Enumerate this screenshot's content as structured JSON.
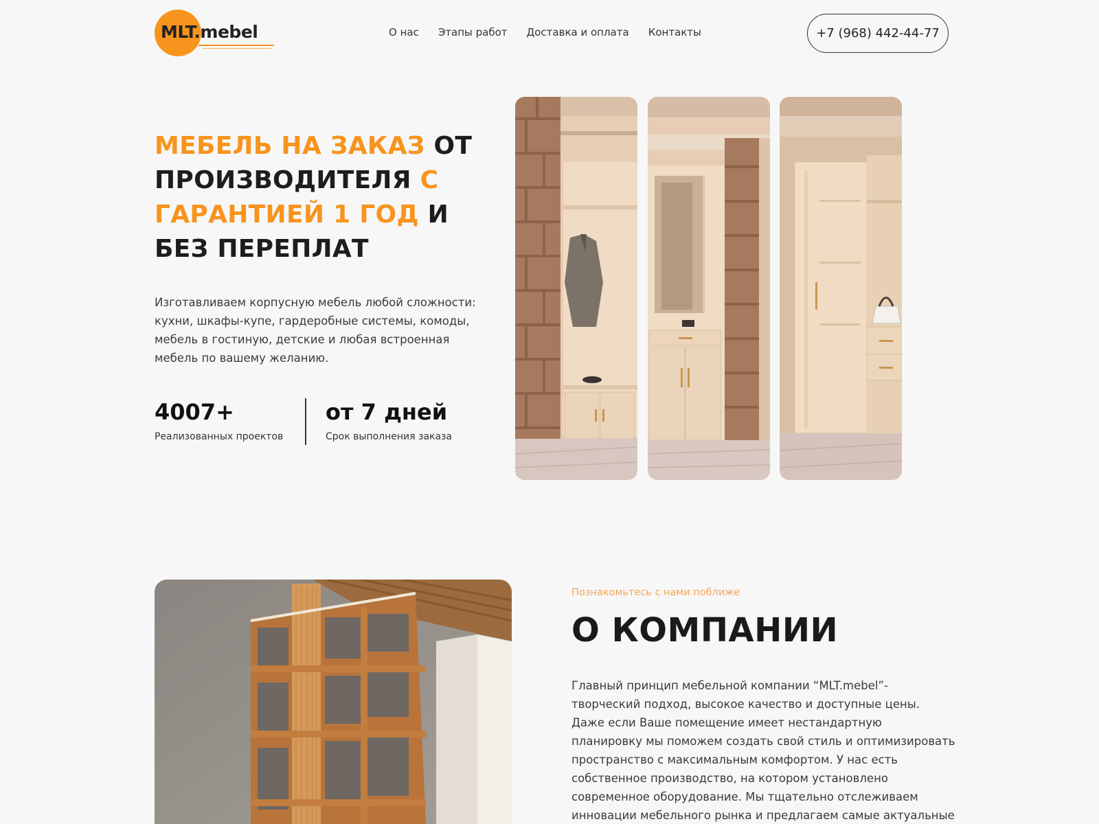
{
  "header": {
    "logo_text": "MLT.mebel",
    "nav": [
      "О нас",
      "Этапы работ",
      "Доставка и оплата",
      "Контакты"
    ],
    "phone": "+7 (968) 442-44-77"
  },
  "hero": {
    "title_parts": [
      {
        "text": "МЕБЕЛЬ НА ЗАКАЗ ",
        "accent": true
      },
      {
        "text": "ОТ ПРОИЗВОДИТЕЛЯ ",
        "accent": false
      },
      {
        "text": "С ГАРАНТИЕЙ 1 ГОД ",
        "accent": true
      },
      {
        "text": "И БЕЗ ПЕРЕПЛАТ",
        "accent": false
      }
    ],
    "description": "Изготавливаем корпусную мебель любой сложности: кухни, шкафы-купе, гардеробные системы, комоды, мебель в гостиную, детские и любая встроенная мебель по вашему желанию.",
    "stats": [
      {
        "value": "4007+",
        "label": "Реализованных проектов"
      },
      {
        "value": "от 7 дней",
        "label": "Срок выполнения заказа"
      }
    ]
  },
  "about": {
    "kicker": "Познакомьтесь с нами поближе",
    "title": "О КОМПАНИИ",
    "text": "Главный принцип мебельной компании “MLT.mebel”-творческий подход, высокое качество и доступные цены. Даже если Ваше помещение имеет нестандартную планировку мы поможем создать свой стиль и оптимизировать пространство с максимальным комфортом. У нас есть собственное производство, на котором установлено современное оборудование. Мы тщательно отслеживаем инновации мебельного рынка и предлагаем самые актуальные решения."
  },
  "colors": {
    "accent": "#f7941d",
    "background": "#f7f7f7",
    "text": "#1c1c1c"
  }
}
